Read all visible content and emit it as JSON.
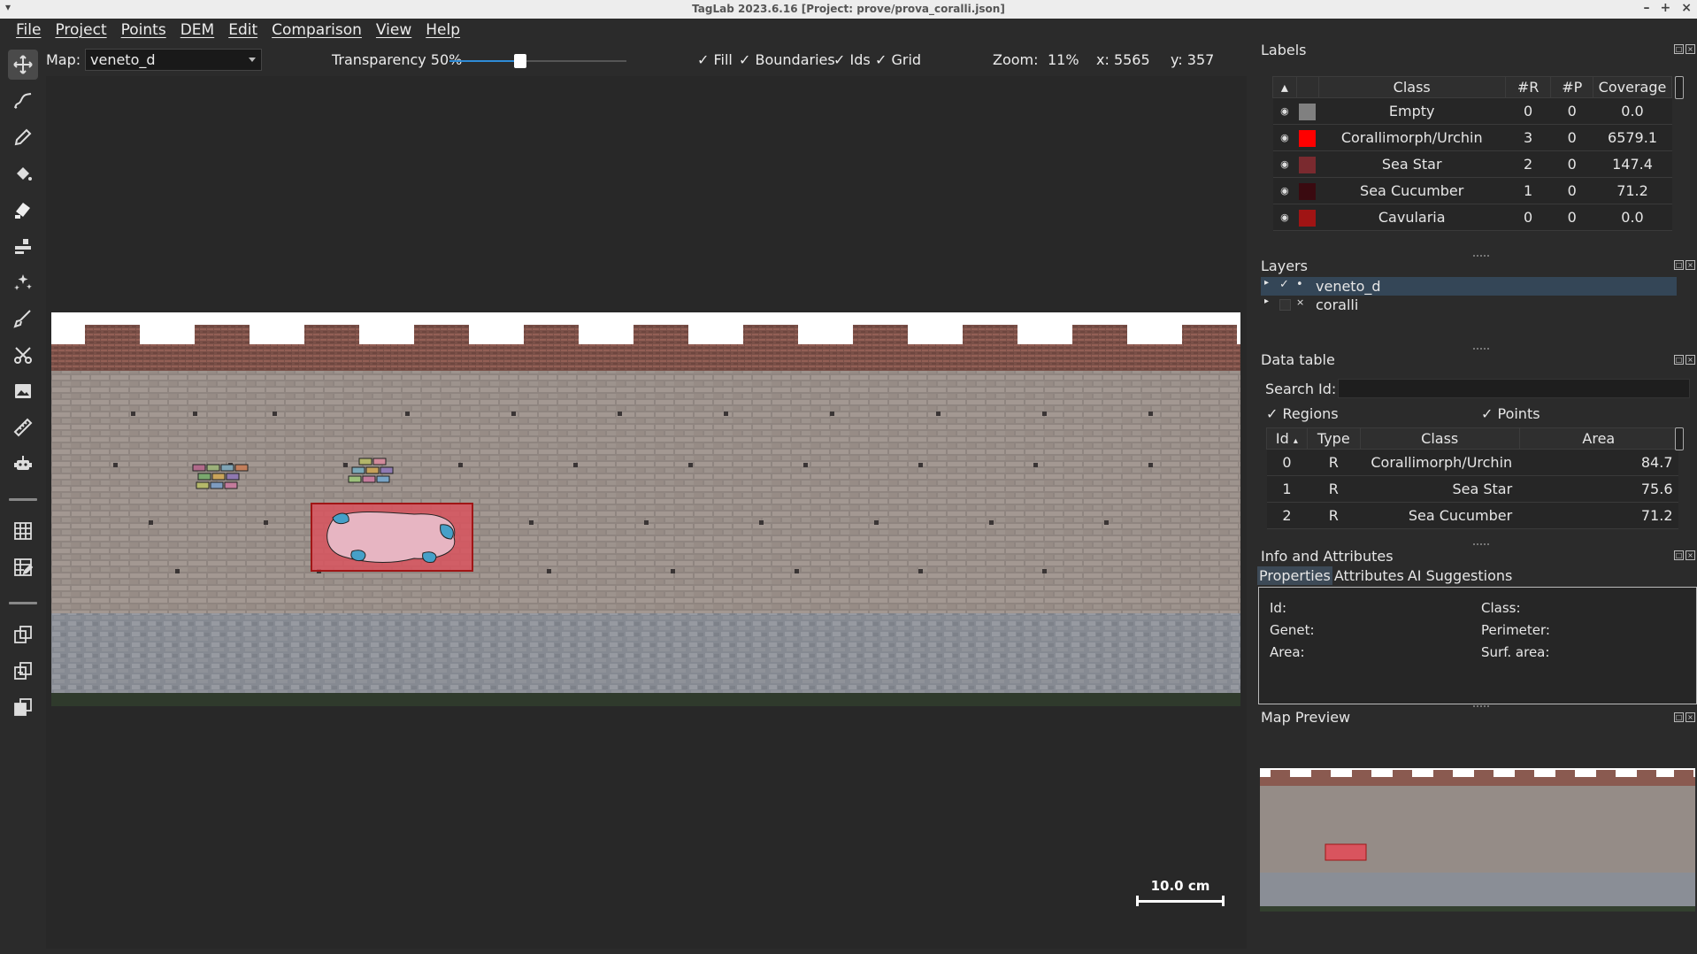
{
  "window": {
    "title": "TagLab 2023.6.16 [Project: prove/prova_coralli.json]",
    "controls": [
      "–",
      "+",
      "×"
    ]
  },
  "menu": [
    "File",
    "Project",
    "Points",
    "DEM",
    "Edit",
    "Comparison",
    "View",
    "Help"
  ],
  "toolbar": {
    "tools": [
      "move-icon",
      "freehand-icon",
      "pencil-icon",
      "bucket-icon",
      "brush-icon",
      "cut-icon",
      "magic-wand-icon",
      "ruler-brush-icon",
      "scissors-icon",
      "image-icon",
      "ruler-icon",
      "robot-icon",
      "grid-icon",
      "edit-grid-icon",
      "split-icon",
      "compare-icon",
      "merge-icon"
    ]
  },
  "controls": {
    "map_label": "Map:",
    "map_value": "veneto_d",
    "transparency_label": "Transparency 50%",
    "transparency_value": 0.5,
    "fill": "✓ Fill",
    "boundaries": "✓ Boundaries",
    "ids": "✓ Ids",
    "grid": "✓ Grid",
    "zoom_label": "Zoom:",
    "zoom_value": "11%",
    "x_label": "x: 5565",
    "y_label": "y: 357"
  },
  "viewer": {
    "scale_label": "10.0 cm"
  },
  "labels_panel": {
    "title": "Labels",
    "headers": [
      "Class",
      "#R",
      "#P",
      "Coverage"
    ],
    "rows": [
      {
        "name": "Empty",
        "r": "0",
        "p": "0",
        "coverage": "0.0",
        "color": "#808080"
      },
      {
        "name": "Corallimorph/Urchin",
        "r": "3",
        "p": "0",
        "coverage": "6579.1",
        "color": "#ff0000"
      },
      {
        "name": "Sea Star",
        "r": "2",
        "p": "0",
        "coverage": "147.4",
        "color": "#7a2a2f"
      },
      {
        "name": "Sea Cucumber",
        "r": "1",
        "p": "0",
        "coverage": "71.2",
        "color": "#3a0a10"
      },
      {
        "name": "Cavularia",
        "r": "0",
        "p": "0",
        "coverage": "0.0",
        "color": "#a01414"
      }
    ]
  },
  "layers_panel": {
    "title": "Layers",
    "items": [
      {
        "name": "veneto_d",
        "check": "✓",
        "eye": "•"
      },
      {
        "name": "coralli",
        "check": "",
        "eye": "×"
      }
    ]
  },
  "data_table": {
    "title": "Data table",
    "search_label": "Search Id:",
    "regions": "✓ Regions",
    "points": "✓ Points",
    "headers": [
      "Id",
      "Type",
      "Class",
      "Area"
    ],
    "rows": [
      {
        "id": "0",
        "type": "R",
        "class": "Corallimorph/Urchin",
        "area": "84.7"
      },
      {
        "id": "1",
        "type": "R",
        "class": "Sea Star",
        "area": "75.6"
      },
      {
        "id": "2",
        "type": "R",
        "class": "Sea Cucumber",
        "area": "71.2"
      }
    ]
  },
  "info_panel": {
    "title": "Info and Attributes",
    "tabs": [
      "Properties",
      "Attributes",
      "AI Suggestions"
    ],
    "fields": {
      "id": "Id:",
      "genet": "Genet:",
      "area": "Area:",
      "class": "Class:",
      "perimeter": "Perimeter:",
      "surf_area": "Surf. area:"
    }
  },
  "map_preview": {
    "title": "Map Preview"
  }
}
